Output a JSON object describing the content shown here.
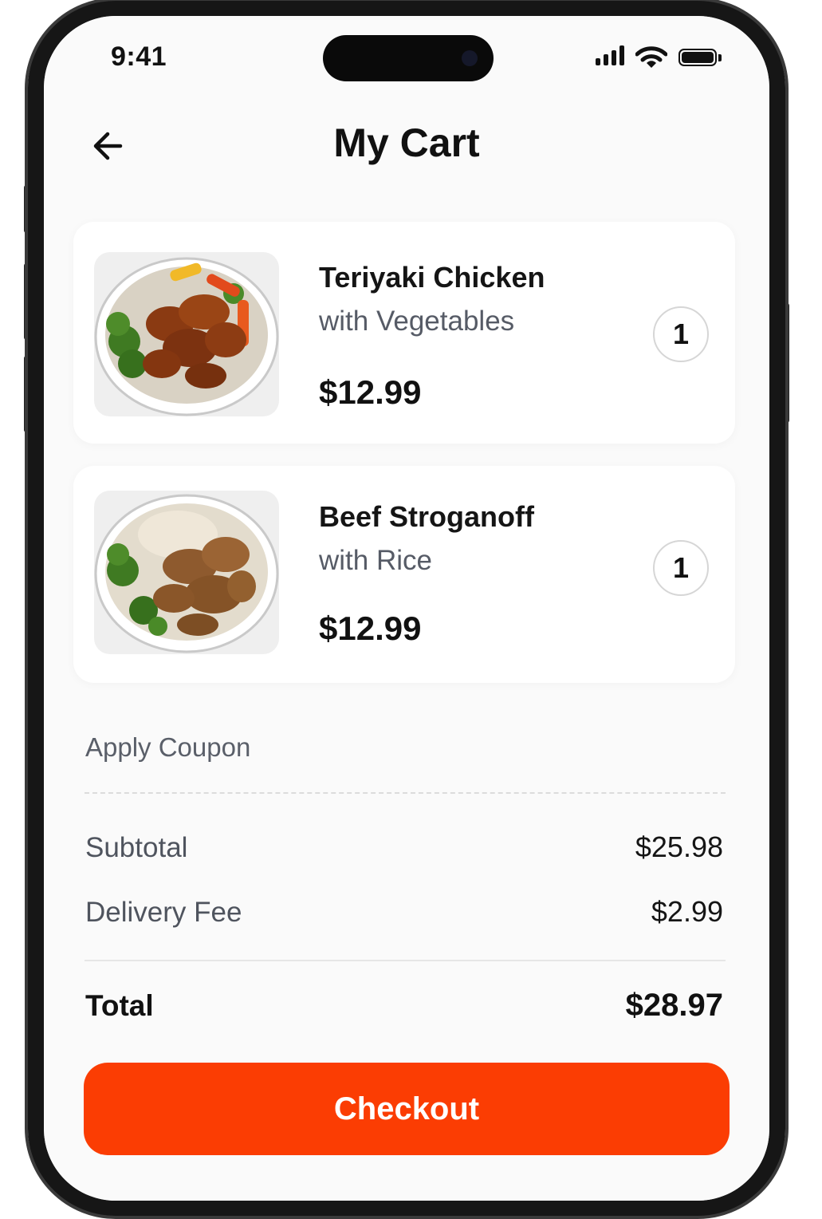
{
  "status_bar": {
    "time": "9:41",
    "icons": [
      "cellular-signal-icon",
      "wifi-icon",
      "battery-icon"
    ]
  },
  "header": {
    "back_icon": "arrow-left-icon",
    "title": "My Cart"
  },
  "cart": {
    "items": [
      {
        "name": "Teriyaki Chicken",
        "subtitle": "with Vegetables",
        "price": "$12.99",
        "quantity": "1",
        "image": "teriyaki-chicken-bowl-image"
      },
      {
        "name": "Beef Stroganoff",
        "subtitle": "with Rice",
        "price": "$12.99",
        "quantity": "1",
        "image": "beef-stroganoff-bowl-image"
      }
    ]
  },
  "coupon": {
    "label": "Apply Coupon"
  },
  "summary": {
    "subtotal_label": "Subtotal",
    "subtotal_value": "$25.98",
    "delivery_label": "Delivery Fee",
    "delivery_value": "$2.99",
    "total_label": "Total",
    "total_value": "$28.97"
  },
  "checkout": {
    "label": "Checkout"
  },
  "colors": {
    "accent": "#fb3d03",
    "background": "#fafafa",
    "card": "#ffffff",
    "text_primary": "#111111",
    "text_secondary": "#565b66"
  }
}
